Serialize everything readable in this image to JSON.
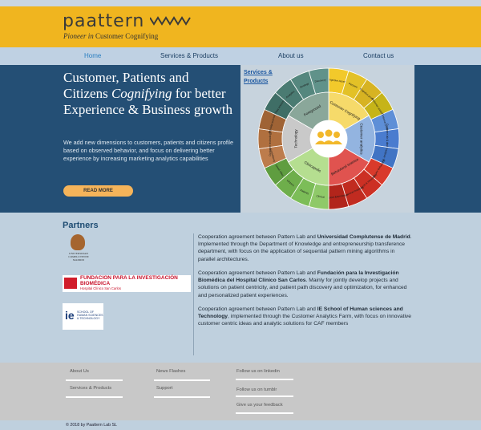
{
  "brand": {
    "logo_text": "paattern",
    "tagline_italic": "Pioneer in",
    "tagline_rest": "Customer Cognifying"
  },
  "nav": {
    "items": [
      {
        "label": "Home",
        "active": true
      },
      {
        "label": "Services & Products",
        "active": false
      },
      {
        "label": "About us",
        "active": false
      },
      {
        "label": "Contact us",
        "active": false
      }
    ]
  },
  "hero": {
    "title_pre": "Customer, Patients and Citizens",
    "title_italic": "Cognifying",
    "title_post": "for better Experience & Business growth",
    "body": "We add new dimensions to customers, patients and citizens profile based on observed behavior, and focus on delivering better experience by increasing marketing analytics capabilities",
    "cta": "READ MORE"
  },
  "wheel": {
    "link_label": "Services & Products",
    "inner_sectors": [
      {
        "label": "Customer Cognifying",
        "color": "#f6da6a"
      },
      {
        "label": "Customer analytics",
        "color": "#93b4e0"
      },
      {
        "label": "Behavioral science",
        "color": "#e0534f"
      },
      {
        "label": "Clinicapolis",
        "color": "#b5de90"
      },
      {
        "label": "Technology",
        "color": "#c9c9c9"
      },
      {
        "label": "Foreground",
        "color": "#8aa79a"
      }
    ],
    "outer_segments": [
      {
        "label": "Cognitive Assets",
        "color": "#f2c92b"
      },
      {
        "label": "Persons",
        "color": "#e3c127"
      },
      {
        "label": "Cognitive profile",
        "color": "#d7b322"
      },
      {
        "label": "Customer analytics",
        "color": "#c6b418"
      },
      {
        "label": "Customer profile",
        "color": "#5e8fd7"
      },
      {
        "label": "Customer lab & dashboard",
        "color": "#4a7ccf"
      },
      {
        "label": "Pat. analytics",
        "color": "#4174c4"
      },
      {
        "label": "Healthcare Behavioral",
        "color": "#d93a2b"
      },
      {
        "label": "Research & Innovation",
        "color": "#cc3024"
      },
      {
        "label": "Behavioral modeling",
        "color": "#c12b20"
      },
      {
        "label": "Patient Experience",
        "color": "#b2251b"
      },
      {
        "label": "Clinical",
        "color": "#8fc969"
      },
      {
        "label": "Patients",
        "color": "#7cbd58"
      },
      {
        "label": "Citizens",
        "color": "#6eae4b"
      },
      {
        "label": "Smart cities",
        "color": "#5f9d40"
      },
      {
        "label": "Consultancy",
        "color": "#bd7c4c"
      },
      {
        "label": "Customer technology roadmap",
        "color": "#b0703f"
      },
      {
        "label": "Big data technology",
        "color": "#9f6335"
      },
      {
        "label": "Data science",
        "color": "#3f6e66"
      },
      {
        "label": "Analytics",
        "color": "#4a7b72"
      },
      {
        "label": "Strategy",
        "color": "#55877e"
      },
      {
        "label": "Discovery",
        "color": "#60928a"
      }
    ]
  },
  "partners": {
    "title": "Partners",
    "ucm_logo_text": "UNIVERSIDAD COMPLUTENSE MADRID",
    "fib_logo_text": "FUNDACION PARA LA INVESTIGACIÓN BIOMÉDICA",
    "fib_logo_sub": "Hospital Clínico San Carlos",
    "ie_logo_text": "SCHOOL OF HUMAN SCIENCES & TECHNOLOGY",
    "items": [
      {
        "pre": "Cooperation agreement between Pattern Lab and ",
        "bold": "Universidad Complutense de Madrid",
        "post": ". Implemented through the Department of Knowledge and entrepreneurship transference department, with focus on the application of sequential pattern mining algorithms in parallel architectures."
      },
      {
        "pre": "Cooperation agreement between Pattern Lab and ",
        "bold": "Fundación para la Investigación Biomédica del Hospital Clínico San Carlos",
        "post": ". Mainly for jointly develop projects and solutions on patient centricity, and patient path discovery and optimization, for enhanced and personalized patient experiences."
      },
      {
        "pre": "Cooperation agreement between Pattern Lab and ",
        "bold": "IE School of Human sciences and Technology",
        "post": ", implemented through the Customer Analytics Farm, with focus on innovative customer centric ideas and analytic solutions for CAF members"
      }
    ]
  },
  "footer": {
    "links": [
      "About Us",
      "Services & Products",
      "News Flashes",
      "Support",
      "Follow us on linkedin",
      "Follow us on tumblr",
      "Give us your feedback"
    ],
    "copyright": "© 2018 by Paattern Lab SL"
  }
}
